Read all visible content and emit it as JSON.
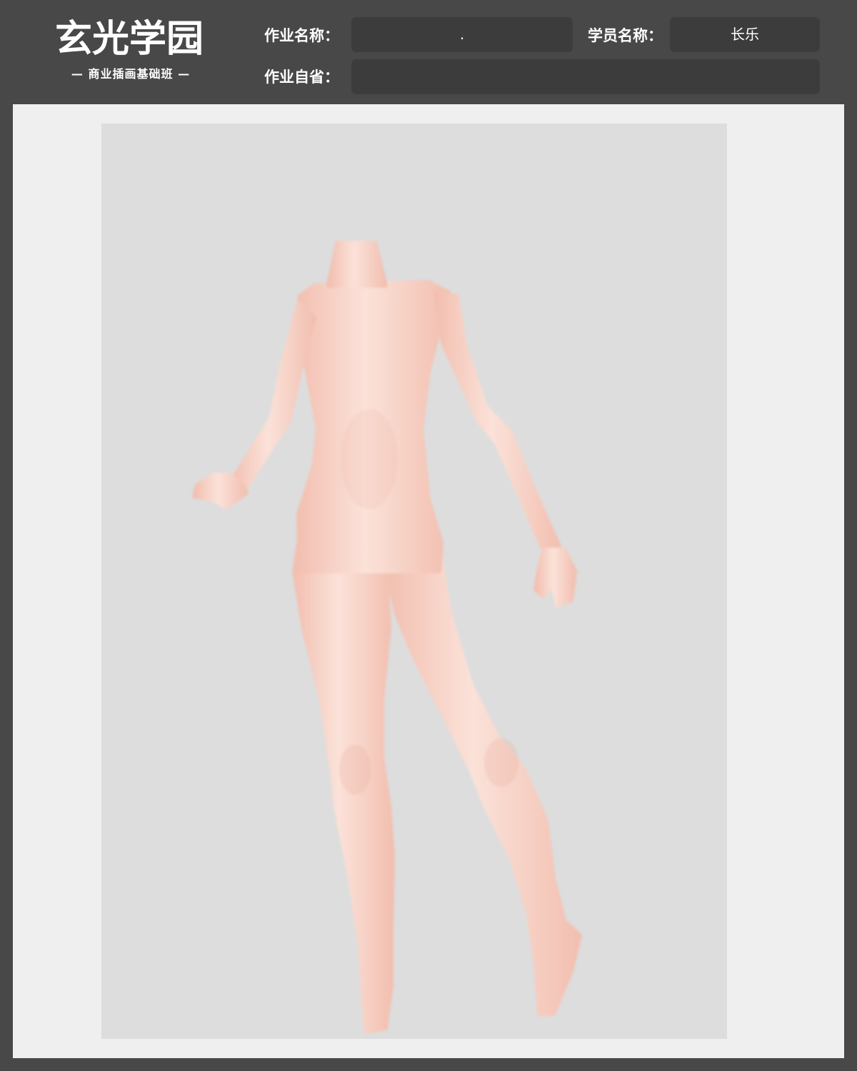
{
  "colors": {
    "header_bg": "#484848",
    "field_bg": "#3c3c3c",
    "canvas_bg": "#efefef",
    "artwork_bg": "#dddddd",
    "skin_light": "#fbe2d9",
    "skin_shadow": "#f2bfb0"
  },
  "logo": {
    "title": "玄光学园",
    "subtitle": "— 商业插画基础班 —"
  },
  "form": {
    "assignment_name": {
      "label": "作业名称：",
      "value": "."
    },
    "student_name": {
      "label": "学员名称：",
      "value": "长乐"
    },
    "self_review": {
      "label": "作业自省："
    }
  }
}
